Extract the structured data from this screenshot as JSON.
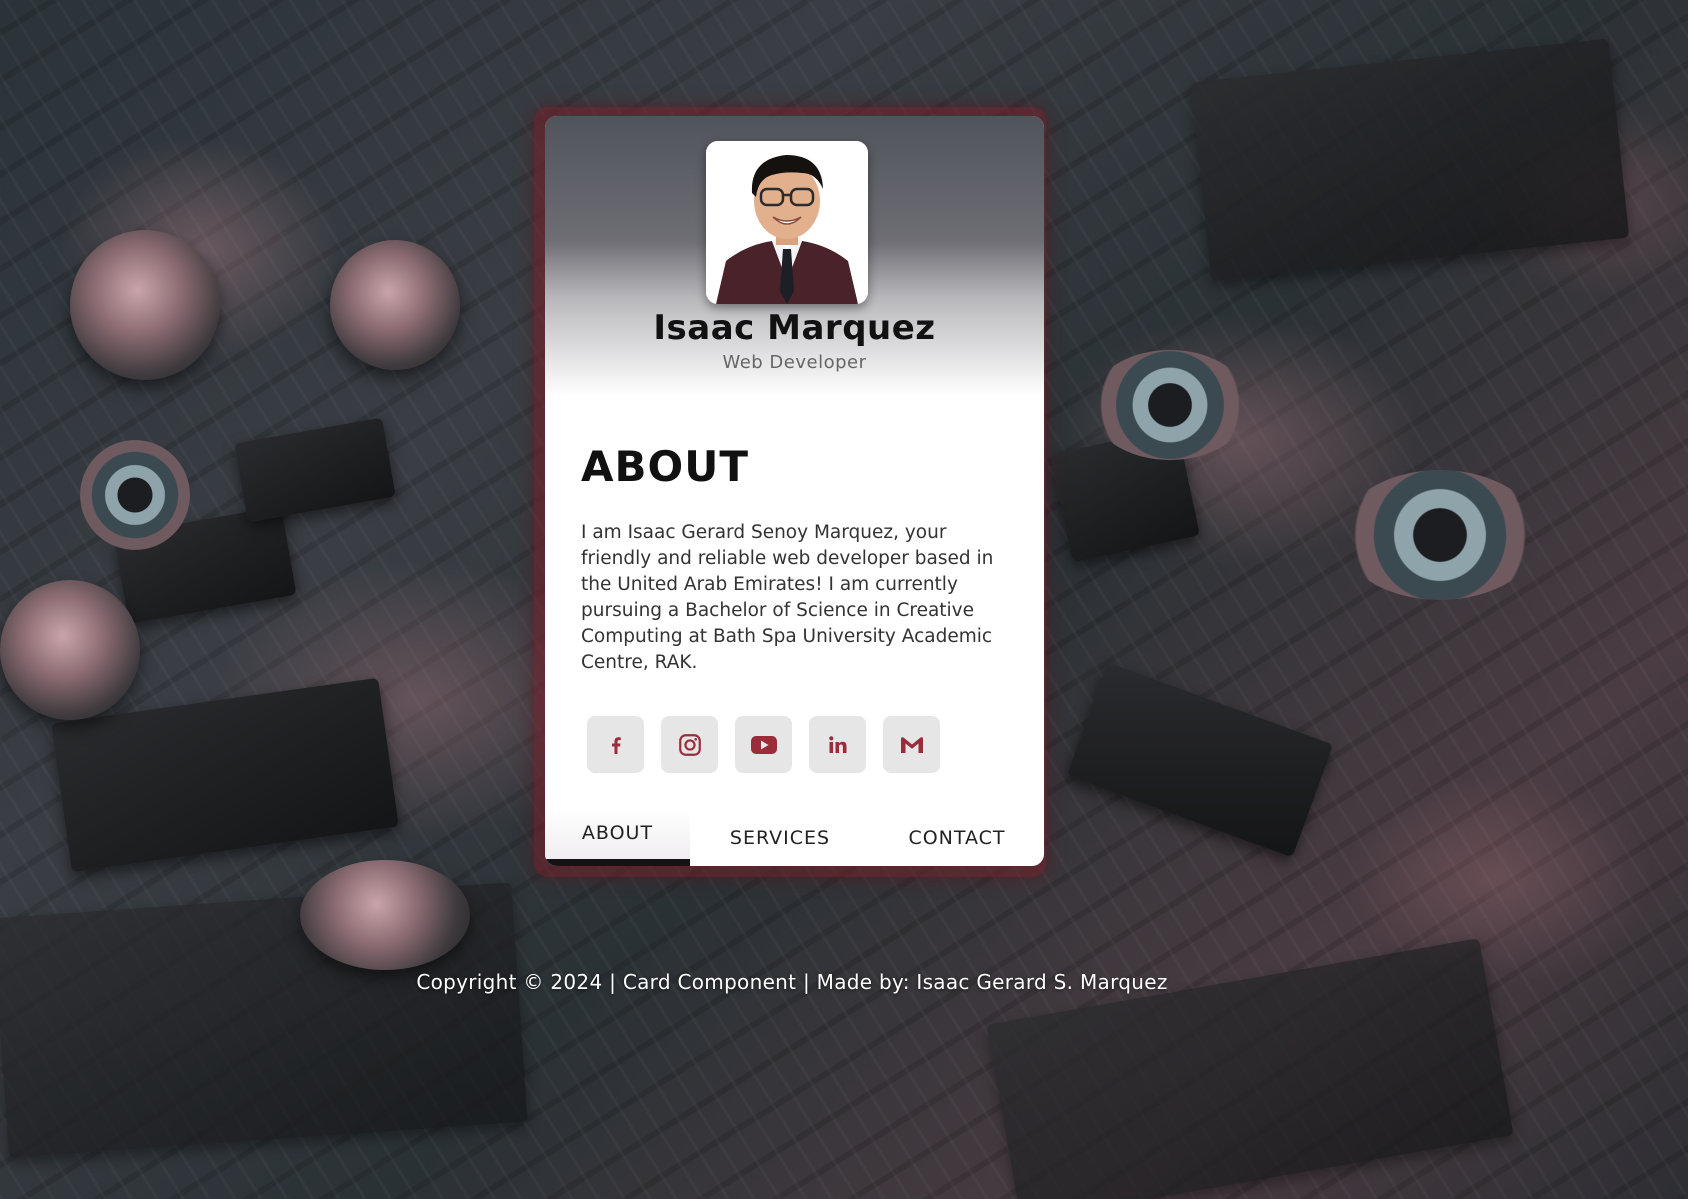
{
  "profile": {
    "name": "Isaac Marquez",
    "role": "Web Developer"
  },
  "about": {
    "title": "ABOUT",
    "text": "I am Isaac Gerard Senoy Marquez, your friendly and reliable web developer based in the United Arab Emirates! I am currently pursuing a Bachelor of Science in Creative Computing at Bath Spa University Academic Centre, RAK."
  },
  "socials": [
    {
      "icon": "facebook-icon"
    },
    {
      "icon": "instagram-icon"
    },
    {
      "icon": "youtube-icon"
    },
    {
      "icon": "linkedin-icon"
    },
    {
      "icon": "gmail-icon"
    }
  ],
  "tabs": {
    "about": "ABOUT",
    "services": "SERVICES",
    "contact": "CONTACT",
    "active": "about"
  },
  "footer": {
    "text": "Copyright © 2024 | Card Component | Made by: Isaac Gerard S. Marquez"
  },
  "colors": {
    "accent": "#9b2c3a",
    "frame": "#7a1e28",
    "icon_bg": "#e6e6e6",
    "active_tab_bar": "#141414"
  }
}
